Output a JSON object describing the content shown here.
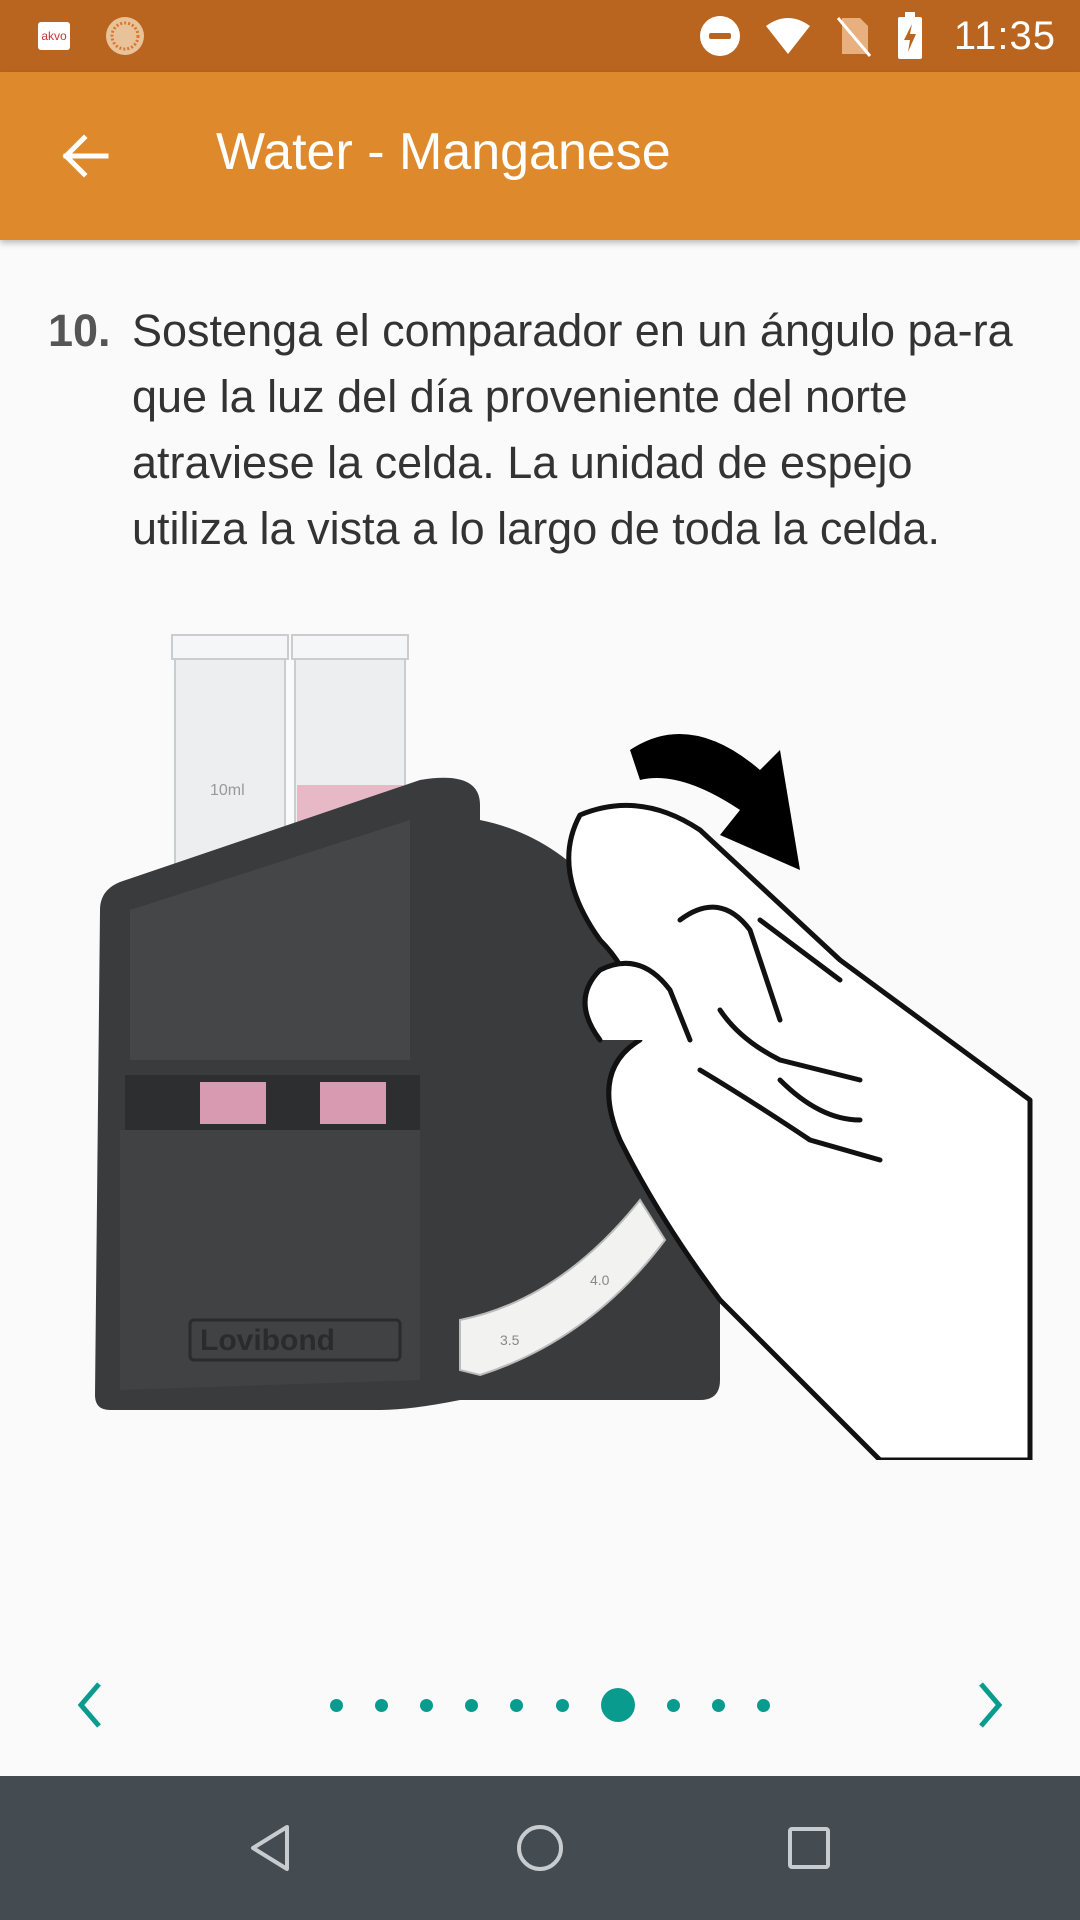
{
  "status_bar": {
    "app_icon_text": "akvo",
    "time": "11:35"
  },
  "app_bar": {
    "title": "Water - Manganese",
    "back_icon": "arrow-left-icon"
  },
  "instruction": {
    "number": "10.",
    "text": "Sostenga el comparador en un ángulo pa-ra que la luz del día proveniente del norte atraviese la celda. La unidad de espejo utiliza la vista a lo largo de toda la celda."
  },
  "illustration": {
    "brand_text": "Lovibond",
    "tube_label": "10ml",
    "scale_labels": [
      "3.5",
      "4.0"
    ]
  },
  "pager": {
    "total_pages": 10,
    "current_page": 7,
    "accent_color": "#0a9b8f"
  },
  "colors": {
    "status_bar": "#b9651f",
    "app_bar": "#de8a2c",
    "nav_bar": "#444b51",
    "background": "#fafafa"
  }
}
